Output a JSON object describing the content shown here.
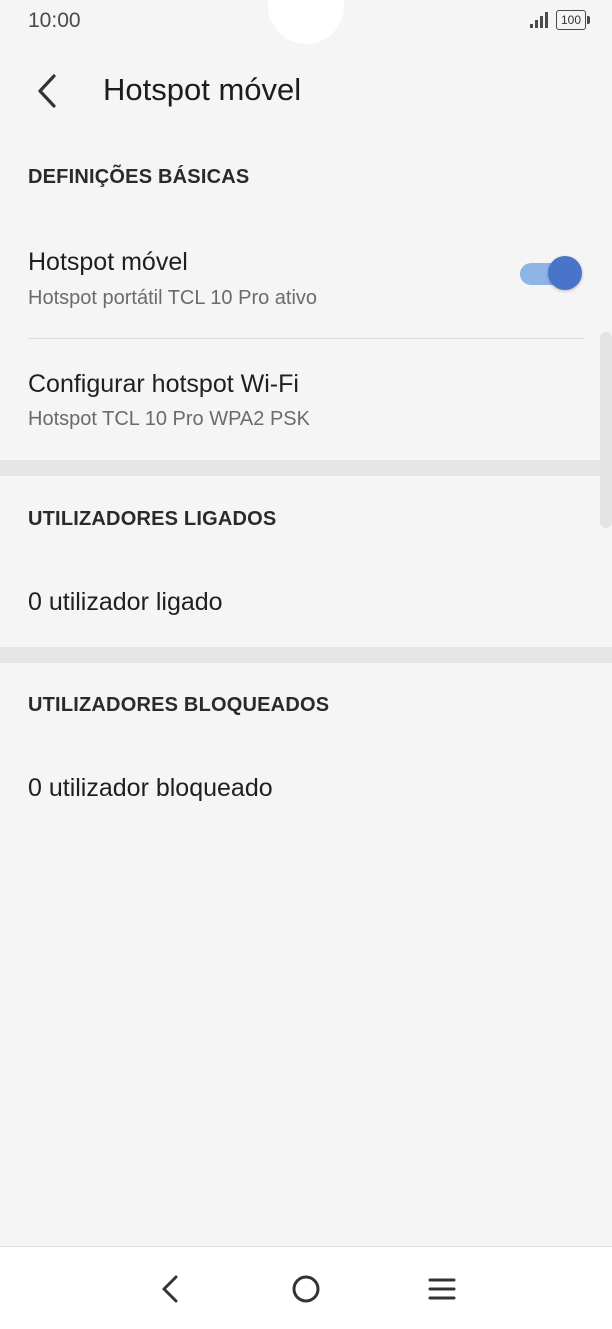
{
  "status_bar": {
    "time": "10:00",
    "battery": "100"
  },
  "header": {
    "title": "Hotspot móvel"
  },
  "sections": {
    "basic": {
      "header": "DEFINIÇÕES BÁSICAS",
      "hotspot": {
        "title": "Hotspot móvel",
        "subtitle": "Hotspot portátil TCL 10 Pro ativo",
        "enabled": true
      },
      "configure": {
        "title": "Configurar hotspot Wi-Fi",
        "subtitle": "Hotspot TCL 10 Pro WPA2 PSK"
      }
    },
    "connected": {
      "header": "UTILIZADORES LIGADOS",
      "item": "0 utilizador ligado"
    },
    "blocked": {
      "header": "UTILIZADORES BLOQUEADOS",
      "item": "0 utilizador bloqueado"
    }
  },
  "colors": {
    "accent": "#4a74c9",
    "track": "#8fb4e6",
    "background": "#f5f5f5"
  },
  "icons": {
    "back": "arrow-back-icon",
    "nav_back": "nav-back-icon",
    "nav_home": "nav-home-icon",
    "nav_menu": "nav-menu-icon"
  }
}
